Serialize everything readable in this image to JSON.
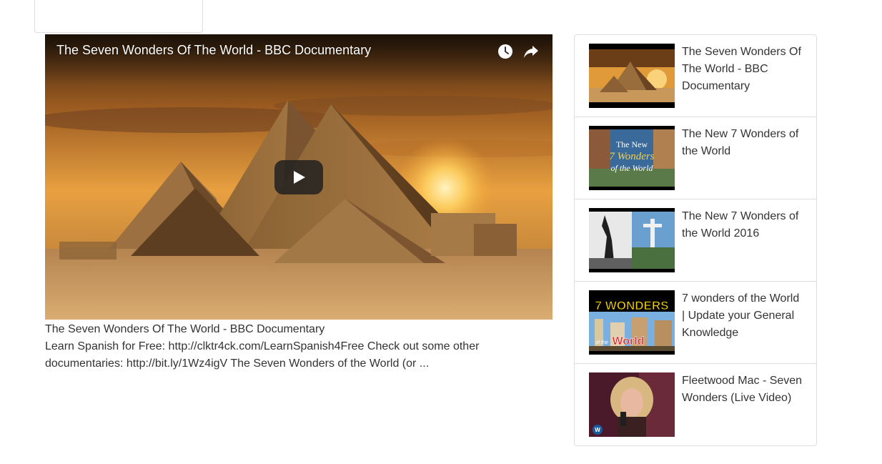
{
  "player": {
    "title": "The Seven Wonders Of The World - BBC Documentary",
    "icons": [
      "watch-later-icon",
      "share-icon",
      "play-icon"
    ]
  },
  "caption": {
    "title": "The Seven Wonders Of The World - BBC Documentary",
    "description": "Learn Spanish for Free: http://clktr4ck.com/LearnSpanish4Free Check out some other documentaries: http://bit.ly/1Wz4igV The Seven Wonders of the World (or ..."
  },
  "playlist": {
    "items": [
      {
        "title": "The Seven Wonders Of The World - BBC Documentary"
      },
      {
        "title": "The New 7 Wonders of the World",
        "thumb_text": [
          "The New",
          "7 Wonders",
          "of the World"
        ]
      },
      {
        "title": "The New 7 Wonders of the World 2016"
      },
      {
        "title": "7 wonders of the World | Update your General Knowledge",
        "thumb_text": [
          "7 WONDERS",
          "of the",
          "World"
        ]
      },
      {
        "title": "Fleetwood Mac - Seven Wonders (Live Video)",
        "thumb_text": [
          "W"
        ]
      }
    ]
  },
  "colors": {
    "border": "#dddddd",
    "text": "#333333",
    "sky_top": "#5a3210",
    "sky_glow": "#f0a030",
    "sand": "#c89a5a"
  }
}
